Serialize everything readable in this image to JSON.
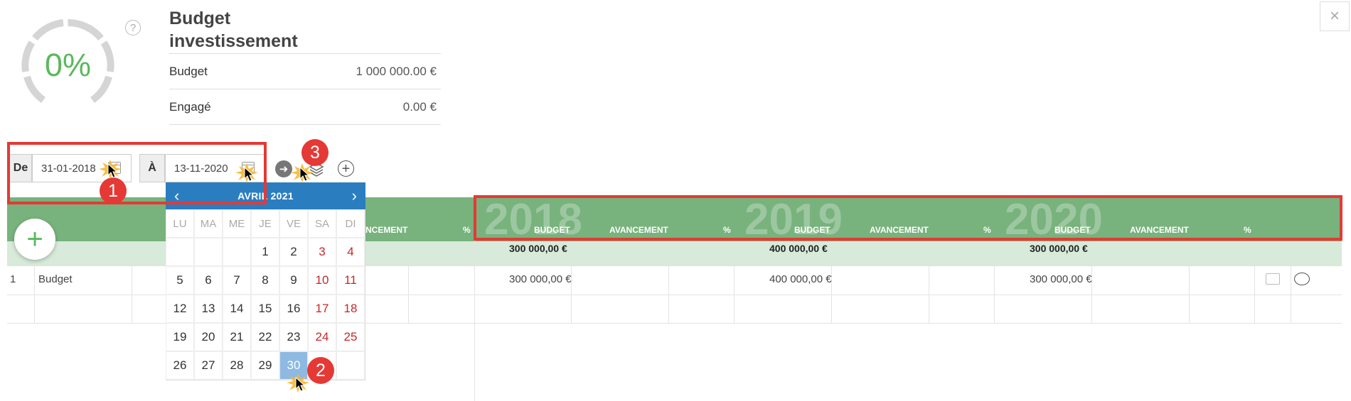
{
  "window": {
    "close_label": "×"
  },
  "gauge": {
    "percent_label": "0%",
    "value": 0,
    "help_label": "?"
  },
  "summary": {
    "title_line1": "Budget",
    "title_line2": "investissement",
    "rows": [
      {
        "label": "Budget",
        "value": "1 000 000.00 €"
      },
      {
        "label": "Engagé",
        "value": "0.00 €"
      }
    ]
  },
  "date_range": {
    "from_label": "De",
    "from_value": "31-01-2018",
    "to_label": "À",
    "to_value": "13-11-2020"
  },
  "toolbar": {
    "go_label": "➜",
    "add_label": "+"
  },
  "annotations": {
    "badge1": "1",
    "badge2": "2",
    "badge3": "3"
  },
  "datepicker": {
    "prev": "‹",
    "next": "›",
    "month_label": "AVRIL 2021",
    "weekdays": [
      "LU",
      "MA",
      "ME",
      "JE",
      "VE",
      "SA",
      "DI"
    ],
    "weeks": [
      [
        "",
        "",
        "",
        "1",
        "2",
        "3",
        "4"
      ],
      [
        "5",
        "6",
        "7",
        "8",
        "9",
        "10",
        "11"
      ],
      [
        "12",
        "13",
        "14",
        "15",
        "16",
        "17",
        "18"
      ],
      [
        "19",
        "20",
        "21",
        "22",
        "23",
        "24",
        "25"
      ],
      [
        "26",
        "27",
        "28",
        "29",
        "30",
        "",
        ""
      ]
    ],
    "selected": "30"
  },
  "grid": {
    "add_row_label": "+",
    "partial_header_avancement": "NCEMENT",
    "partial_header_pct": "%",
    "years": [
      {
        "year": "2018",
        "budget_header": "BUDGET",
        "avancement_header": "AVANCEMENT",
        "pct_header": "%",
        "total": "300 000,00 €",
        "row_budget": "300 000,00 €"
      },
      {
        "year": "2019",
        "budget_header": "BUDGET",
        "avancement_header": "AVANCEMENT",
        "pct_header": "%",
        "total": "400 000,00 €",
        "row_budget": "400 000,00 €"
      },
      {
        "year": "2020",
        "budget_header": "BUDGET",
        "avancement_header": "AVANCEMENT",
        "pct_header": "%",
        "total": "300 000,00 €",
        "row_budget": "300 000,00 €"
      }
    ],
    "rows": [
      {
        "num": "1",
        "label": "Budget"
      }
    ]
  },
  "colors": {
    "header_green": "#78b27d",
    "total_green": "#d8ead9",
    "datepicker_blue": "#2a7ec0",
    "annotation_red": "#e53935"
  }
}
